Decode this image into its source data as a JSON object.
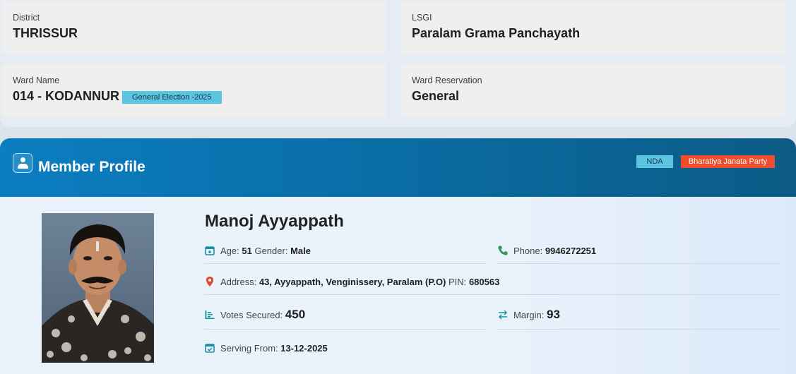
{
  "district": {
    "label": "District",
    "value": "THRISSUR"
  },
  "lsgi": {
    "label": "LSGI",
    "value": "Paralam Grama Panchayath"
  },
  "ward": {
    "label": "Ward Name",
    "value": "014 - KODANNUR",
    "badge": "General Election -2025"
  },
  "reservation": {
    "label": "Ward Reservation",
    "value": "General"
  },
  "profile": {
    "title": "Member Profile",
    "alliance": "NDA",
    "party": "Bharatiya Janata Party",
    "name": "Manoj Ayyappath",
    "age_label": "Age:",
    "age": "51",
    "gender_label": "Gender:",
    "gender": "Male",
    "phone_label": "Phone:",
    "phone": "9946272251",
    "address_label": "Address:",
    "address": "43, Ayyappath, Venginissery, Paralam (P.O)",
    "pin_label": "PIN:",
    "pin": "680563",
    "votes_label": "Votes Secured:",
    "votes": "450",
    "margin_label": "Margin:",
    "margin": "93",
    "serving_label": "Serving From:",
    "serving": "13-12-2025"
  },
  "colors": {
    "header_start": "#0b7ec1",
    "header_end": "#0c5b86",
    "badge_blue": "#5bc4e0",
    "badge_party": "#ef4d2d",
    "icon_teal": "#1a8fa8",
    "icon_green": "#2f9a55",
    "icon_red": "#e04a2b"
  },
  "icons": [
    "user-icon",
    "calendar-icon",
    "phone-icon",
    "location-pin-icon",
    "votes-list-icon",
    "margin-arrows-icon",
    "serving-calendar-icon"
  ]
}
